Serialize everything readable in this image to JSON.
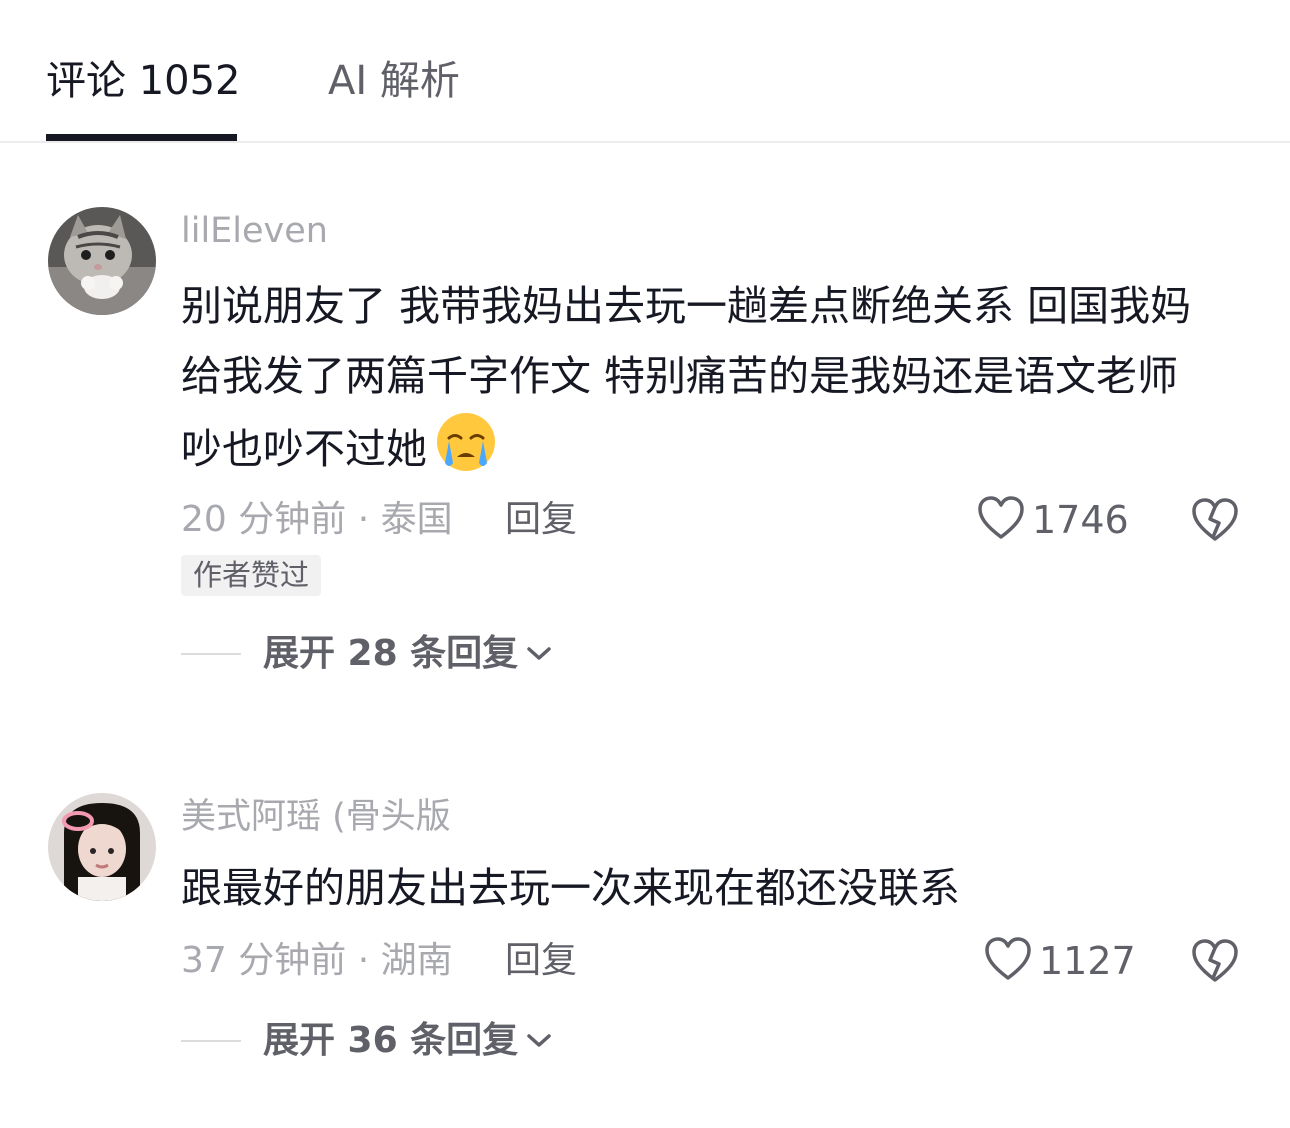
{
  "tabs": [
    {
      "label": "评论 1052",
      "active": true
    },
    {
      "label": "AI 解析",
      "active": false
    }
  ],
  "comments": [
    {
      "author": "lilEleven",
      "text": "别说朋友了 我带我妈出去玩一趟差点断绝关系 回国我妈给我发了两篇千字作文 特别痛苦的是我妈还是语文老师 吵也吵不过她",
      "emoji": "crying-face-emoji",
      "meta": "20 分钟前 · 泰国",
      "reply_label": "回复",
      "likes": "1746",
      "badge": "作者赞过",
      "expand_label": "展开 28 条回复"
    },
    {
      "author": "美式阿瑶 (骨头版",
      "text": "跟最好的朋友出去玩一次来现在都还没联系",
      "meta": "37 分钟前 · 湖南",
      "reply_label": "回复",
      "likes": "1127",
      "expand_label": "展开 36 条回复"
    }
  ],
  "icons": {
    "like": "heart-outline-icon",
    "dislike": "broken-heart-icon",
    "expand": "chevron-down-icon"
  },
  "colors": {
    "primary_text": "#161823",
    "secondary_text": "#5f6068",
    "muted_text": "#a8a9ae",
    "badge_bg": "#f1f1f2"
  }
}
